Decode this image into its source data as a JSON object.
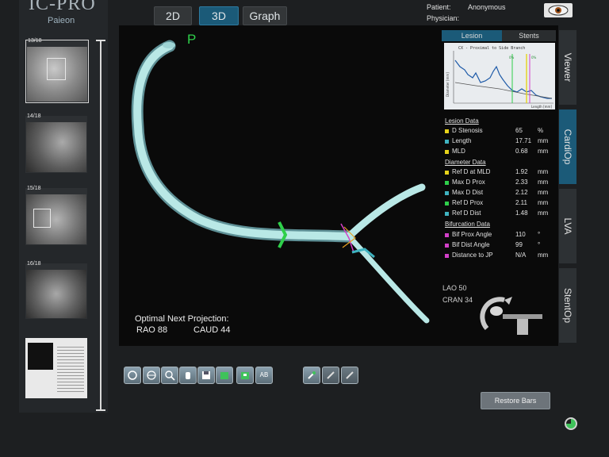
{
  "app": {
    "logo": "IC-PRO",
    "subtitle": "Paieon"
  },
  "view_tabs": [
    {
      "label": "2D"
    },
    {
      "label": "3D"
    },
    {
      "label": "Graph"
    }
  ],
  "patient": {
    "patient_label": "Patient:",
    "patient_value": "Anonymous",
    "physician_label": "Physician:"
  },
  "thumbnails": [
    {
      "label": "13/18"
    },
    {
      "label": "14/18"
    },
    {
      "label": "15/18"
    },
    {
      "label": "16/18"
    },
    {
      "label": ""
    }
  ],
  "viewport": {
    "proximal_marker": "P",
    "optimal_title": "Optimal Next Projection:",
    "optimal_rao": "RAO 88",
    "optimal_caud": "CAUD 44",
    "orientation_lao": "LAO 50",
    "orientation_cran": "CRAN 34"
  },
  "panel": {
    "tabs": [
      {
        "label": "Lesion"
      },
      {
        "label": "Stents"
      }
    ],
    "graph_title": "CX - Proximal to Side Branch",
    "graph_ylabel": "Diameter [mm]",
    "graph_xlabel": "Length [mm]",
    "graph_markers": [
      "0%",
      "0%"
    ],
    "sections": {
      "lesion": "Lesion Data",
      "diameter": "Diameter Data",
      "bifurcation": "Bifurcation Data"
    },
    "lesion_rows": [
      {
        "label": "D Stenosis",
        "value": "65",
        "unit": "%",
        "color": "#e6d21a"
      },
      {
        "label": "Length",
        "value": "17.71",
        "unit": "mm",
        "color": "#3fb3c0"
      },
      {
        "label": "MLD",
        "value": "0.68",
        "unit": "mm",
        "color": "#e6d21a"
      }
    ],
    "diameter_rows": [
      {
        "label": "Ref D at MLD",
        "value": "1.92",
        "unit": "mm",
        "color": "#e6d21a"
      },
      {
        "label": "Max D Prox",
        "value": "2.33",
        "unit": "mm",
        "color": "#2ecf4a"
      },
      {
        "label": "Max D Dist",
        "value": "2.12",
        "unit": "mm",
        "color": "#3fb3c0"
      },
      {
        "label": "Ref D Prox",
        "value": "2.11",
        "unit": "mm",
        "color": "#2ecf4a"
      },
      {
        "label": "Ref D Dist",
        "value": "1.48",
        "unit": "mm",
        "color": "#3fb3c0"
      }
    ],
    "bifurcation_rows": [
      {
        "label": "Bif Prox Angle",
        "value": "110",
        "unit": "°",
        "color": "#d23fc8"
      },
      {
        "label": "Bif Dist Angle",
        "value": "99",
        "unit": "°",
        "color": "#d23fc8"
      },
      {
        "label": "Distance to JP",
        "value": "N/A",
        "unit": "mm",
        "color": "#d23fc8"
      }
    ]
  },
  "vertical_tabs": [
    {
      "label": "Viewer"
    },
    {
      "label": "CardiOp"
    },
    {
      "label": "LVA"
    },
    {
      "label": "StentOp"
    }
  ],
  "toolbar": {
    "ab_label": "AB"
  },
  "restore_label": "Restore Bars"
}
